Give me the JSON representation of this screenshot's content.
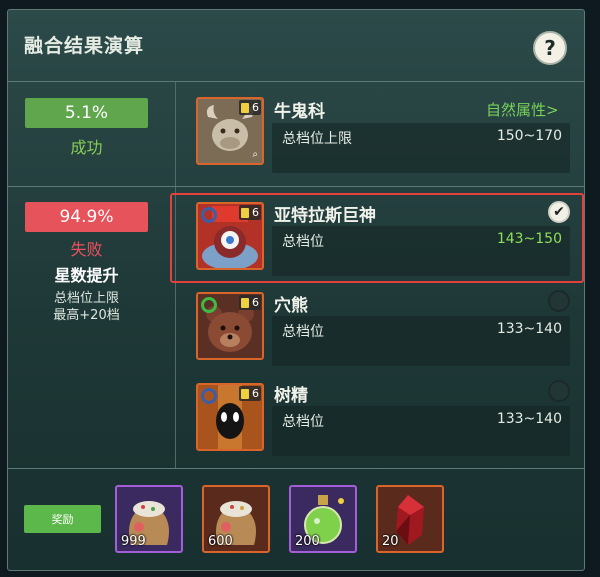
{
  "title": "融合结果演算",
  "help_label": "?",
  "success": {
    "rate": "5.1%",
    "label": "成功"
  },
  "failure": {
    "rate": "94.9%",
    "label": "失败",
    "bonus": "星数提升",
    "note_line1": "总档位上限",
    "note_line2": "最高+20档"
  },
  "monsters": [
    {
      "name": "牛鬼科",
      "level": "6",
      "stat_label": "总档位上限",
      "stat_value": "150~170",
      "link": "自然属性>",
      "selected": false
    },
    {
      "name": "亚特拉斯巨神",
      "level": "6",
      "stat_label": "总档位",
      "stat_value": "143~150",
      "selected": true
    },
    {
      "name": "穴熊",
      "level": "6",
      "stat_label": "总档位",
      "stat_value": "133~140",
      "selected": false
    },
    {
      "name": "树精",
      "level": "6",
      "stat_label": "总档位",
      "stat_value": "133~140",
      "selected": false
    }
  ],
  "rewards": {
    "label": "奖励",
    "items": [
      {
        "icon": "seed-bag-icon",
        "count": "999",
        "rarity": "purple"
      },
      {
        "icon": "seed-bag-icon",
        "count": "600",
        "rarity": "orange"
      },
      {
        "icon": "potion-bottle-icon",
        "count": "200",
        "rarity": "purple"
      },
      {
        "icon": "red-crystal-icon",
        "count": "20",
        "rarity": "orange"
      }
    ]
  },
  "colors": {
    "success": "#5fa64d",
    "failure": "#e7535a",
    "highlight": "#e3403f",
    "accent_green": "#8ee05a"
  }
}
